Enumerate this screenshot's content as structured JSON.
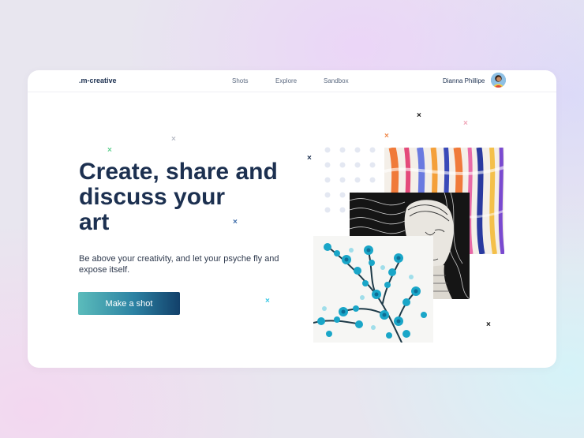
{
  "nav": {
    "logo": ".m-creative",
    "links": [
      "Shots",
      "Explore",
      "Sandbox"
    ],
    "user_name": "Dianna Phillipe"
  },
  "hero": {
    "title_lines": [
      "Create, share and",
      "discuss your",
      "art"
    ],
    "subtitle": "Be above your creativity, and let your psyche fly and expose itself.",
    "cta_label": "Make a shot"
  },
  "decor": {
    "cross_glyph": "×",
    "colors": {
      "navy": "#1c3050",
      "accent_teal": "#5bbcbb",
      "green": "#5ccf8c",
      "grey": "#b8bcc6",
      "blue": "#3a6aa8",
      "cyan": "#3ac8e4",
      "orange": "#f0884a",
      "pink": "#f0a6b8",
      "black": "#111111"
    }
  },
  "artworks": [
    {
      "name": "abstract-paint-strokes"
    },
    {
      "name": "engraved-portrait-bust"
    },
    {
      "name": "blue-cherry-blossom-watercolor"
    }
  ]
}
